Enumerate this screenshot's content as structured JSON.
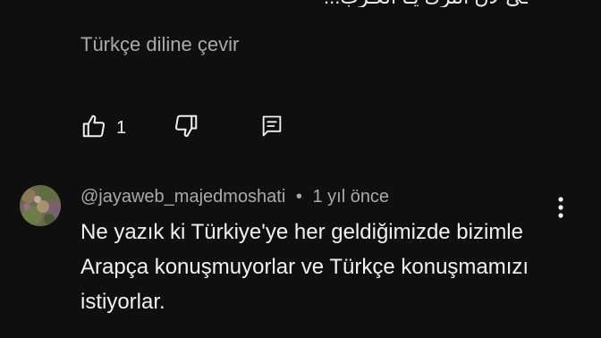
{
  "previous_comment": {
    "tail_text": "ـي لآن الترك يـا العـرب...",
    "translate_label": "Türkçe diline çevir",
    "like_count": "1"
  },
  "comment": {
    "author": "@jayaweb_majedmoshati",
    "separator": "•",
    "time": "1 yıl önce",
    "text": "Ne yazık ki Türkiye'ye her geldiğimizde bizimle Arapça konuşmuyorlar ve Türkçe konuşmamızı istiyorlar."
  },
  "icons": {
    "like": "thumb-up-icon",
    "dislike": "thumb-down-icon",
    "reply": "comment-icon",
    "more": "more-vert-icon"
  },
  "colors": {
    "background": "#0f0f0f",
    "primary_text": "#f1f1f1",
    "secondary_text": "#aaaaaa"
  }
}
